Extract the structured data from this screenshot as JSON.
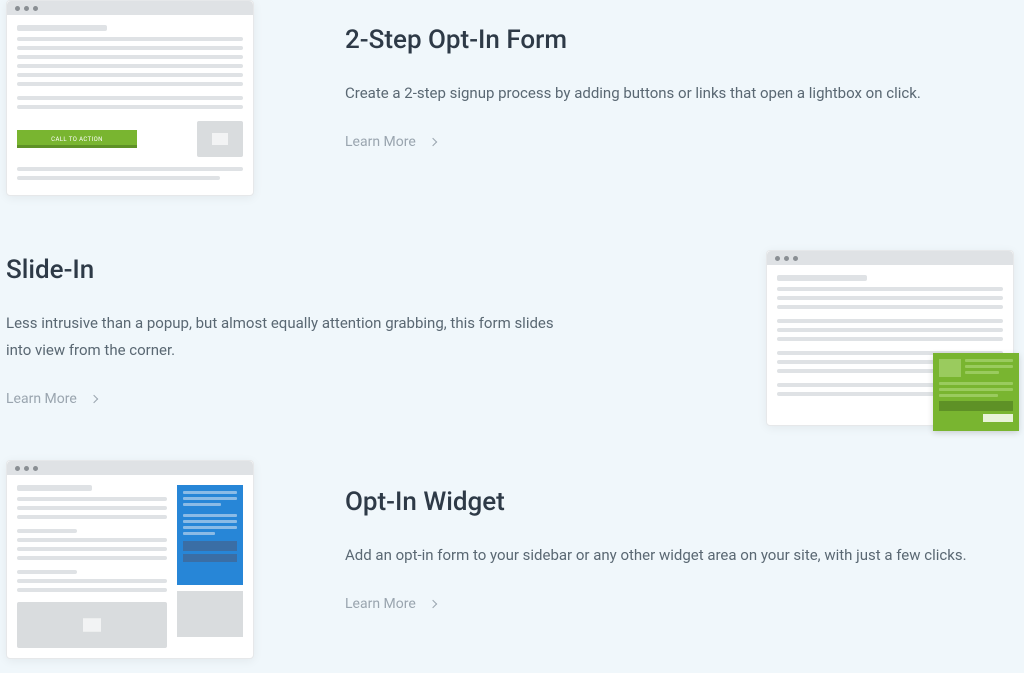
{
  "features": [
    {
      "title": "2-Step Opt-In Form",
      "desc": "Create a 2-step signup process by adding buttons or links that open a lightbox on click.",
      "learn_more": "Learn More",
      "cta_label": "CALL TO ACTION"
    },
    {
      "title": "Slide-In",
      "desc": "Less intrusive than a popup, but almost equally attention grabbing, this form slides into view from the corner.",
      "learn_more": "Learn More"
    },
    {
      "title": "Opt-In Widget",
      "desc": "Add an opt-in form to your sidebar or any other widget area on your site, with just a few clicks.",
      "learn_more": "Learn More"
    }
  ]
}
